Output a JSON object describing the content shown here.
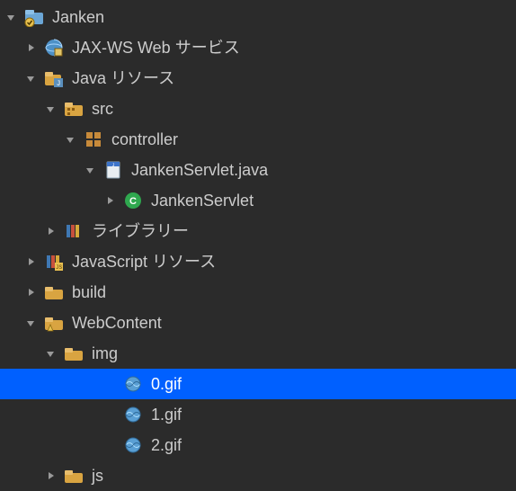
{
  "tree": {
    "items": [
      {
        "indent": 0,
        "expanded": true,
        "hasTwisty": true,
        "selected": false,
        "icon": "project",
        "label": "Janken"
      },
      {
        "indent": 22,
        "expanded": false,
        "hasTwisty": true,
        "selected": false,
        "icon": "jaxws",
        "label": "JAX-WS Web サービス"
      },
      {
        "indent": 22,
        "expanded": true,
        "hasTwisty": true,
        "selected": false,
        "icon": "javares",
        "label": "Java リソース"
      },
      {
        "indent": 44,
        "expanded": true,
        "hasTwisty": true,
        "selected": false,
        "icon": "srcfolder",
        "label": "src"
      },
      {
        "indent": 66,
        "expanded": true,
        "hasTwisty": true,
        "selected": false,
        "icon": "package",
        "label": "controller"
      },
      {
        "indent": 88,
        "expanded": true,
        "hasTwisty": true,
        "selected": false,
        "icon": "javafile",
        "label": "JankenServlet.java"
      },
      {
        "indent": 110,
        "expanded": false,
        "hasTwisty": true,
        "selected": false,
        "icon": "class",
        "label": "JankenServlet"
      },
      {
        "indent": 44,
        "expanded": false,
        "hasTwisty": true,
        "selected": false,
        "icon": "library",
        "label": "ライブラリー"
      },
      {
        "indent": 22,
        "expanded": false,
        "hasTwisty": true,
        "selected": false,
        "icon": "jsres",
        "label": "JavaScript リソース"
      },
      {
        "indent": 22,
        "expanded": false,
        "hasTwisty": true,
        "selected": false,
        "icon": "folder",
        "label": "build"
      },
      {
        "indent": 22,
        "expanded": true,
        "hasTwisty": true,
        "selected": false,
        "icon": "webfolder",
        "label": "WebContent"
      },
      {
        "indent": 44,
        "expanded": true,
        "hasTwisty": true,
        "selected": false,
        "icon": "folder",
        "label": "img"
      },
      {
        "indent": 66,
        "expanded": false,
        "hasTwisty": false,
        "selected": true,
        "icon": "gif",
        "label": "0.gif"
      },
      {
        "indent": 66,
        "expanded": false,
        "hasTwisty": false,
        "selected": false,
        "icon": "gif",
        "label": "1.gif"
      },
      {
        "indent": 66,
        "expanded": false,
        "hasTwisty": false,
        "selected": false,
        "icon": "gif",
        "label": "2.gif"
      },
      {
        "indent": 44,
        "expanded": false,
        "hasTwisty": true,
        "selected": false,
        "icon": "folder",
        "label": "js"
      }
    ]
  },
  "colors": {
    "bg": "#2b2b2b",
    "text": "#cccccc",
    "selection": "#0060ff"
  }
}
